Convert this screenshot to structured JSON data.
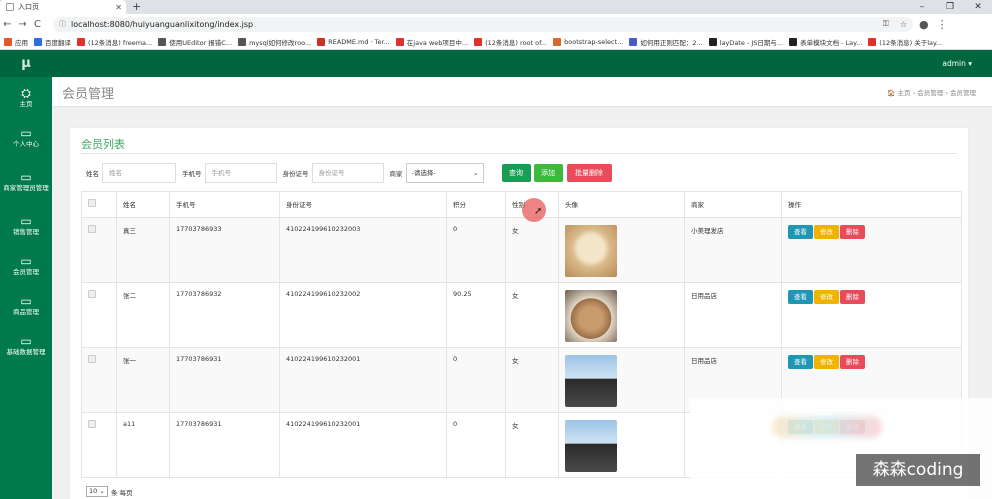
{
  "browser": {
    "tab_title": "入口页",
    "new_tab_symbol": "+",
    "url": "localhost:8080/huiyuanguanlixitong/index.jsp",
    "nav": {
      "back": "←",
      "forward": "→",
      "reload": "C"
    },
    "win": {
      "minimize": "–",
      "maximize": "❐",
      "close": "✕"
    },
    "bookmarks": [
      {
        "label": "应用",
        "color": "#e8562b"
      },
      {
        "label": "百度翻译",
        "color": "#2a6fdb"
      },
      {
        "label": "(12条消息) freema...",
        "color": "#e0302b"
      },
      {
        "label": "使用UEditor 报错C...",
        "color": "#555555"
      },
      {
        "label": "mysql如何修改roo...",
        "color": "#555555"
      },
      {
        "label": "README.md · Ter...",
        "color": "#c8322b"
      },
      {
        "label": "在java web项目中...",
        "color": "#e0302b"
      },
      {
        "label": "(12条消息) root of...",
        "color": "#e0302b"
      },
      {
        "label": "bootstrap-select...",
        "color": "#d66a2a"
      },
      {
        "label": "如何用正则匹配：2...",
        "color": "#4a5bc7"
      },
      {
        "label": "layDate - JS日期与...",
        "color": "#222222"
      },
      {
        "label": "表单模块文档 - Lay...",
        "color": "#222222"
      },
      {
        "label": "(12条消息) 关于lay...",
        "color": "#e0302b"
      }
    ]
  },
  "app": {
    "logo": "μ",
    "admin_label": "admin ▾",
    "sidebar": [
      {
        "icon": "⛭",
        "label": "主页"
      },
      {
        "icon": "▭",
        "label": "个人中心"
      },
      {
        "icon": "▭",
        "label": "商家管理员管理"
      },
      {
        "icon": "▭",
        "label": "销售管理"
      },
      {
        "icon": "▭",
        "label": "会员管理"
      },
      {
        "icon": "▭",
        "label": "商品管理"
      },
      {
        "icon": "▭",
        "label": "基础数据管理"
      }
    ],
    "page_title": "会员管理",
    "breadcrumb": "🏠 主页  ›  会员管理  ›  会员管理",
    "panel_title": "会员列表",
    "filters": {
      "name_label": "姓名",
      "name_placeholder": "姓名",
      "phone_label": "手机号",
      "phone_placeholder": "手机号",
      "id_label": "身份证号",
      "id_placeholder": "身份证号",
      "shop_label": "商家",
      "shop_value": "-请选择-",
      "search_btn": "查询",
      "add_btn": "添加",
      "batch_delete_btn": "批量删除"
    },
    "colors": {
      "search": "#1a9c55",
      "add": "#3cb83c",
      "delete": "#e84b5a",
      "view": "#1f97b3",
      "edit": "#f0b400"
    },
    "table": {
      "headers": [
        "",
        "姓名",
        "手机号",
        "身份证号",
        "积分",
        "性别",
        "头像",
        "商家",
        "操作"
      ],
      "rows": [
        {
          "name": "真三",
          "phone": "17703786933",
          "idcard": "410224199610232003",
          "points": "0",
          "gender": "女",
          "avatar": "dog-photo",
          "shop": "小美理发店"
        },
        {
          "name": "张二",
          "phone": "17703786932",
          "idcard": "410224199610232002",
          "points": "90.25",
          "gender": "女",
          "avatar": "cat-photo",
          "shop": "日用品店"
        },
        {
          "name": "张一",
          "phone": "17703786931",
          "idcard": "410224199610232001",
          "points": "0",
          "gender": "女",
          "avatar": "person-photo",
          "shop": "日用品店"
        },
        {
          "name": "a11",
          "phone": "17703786931",
          "idcard": "410224199610232001",
          "points": "0",
          "gender": "女",
          "avatar": "person-photo",
          "shop": ""
        }
      ],
      "ops": {
        "view": "查看",
        "edit": "修改",
        "delete": "删除"
      }
    },
    "pager": {
      "size": "10",
      "suffix": "条 每页"
    }
  },
  "overlay": {
    "watermark": "森森coding"
  }
}
